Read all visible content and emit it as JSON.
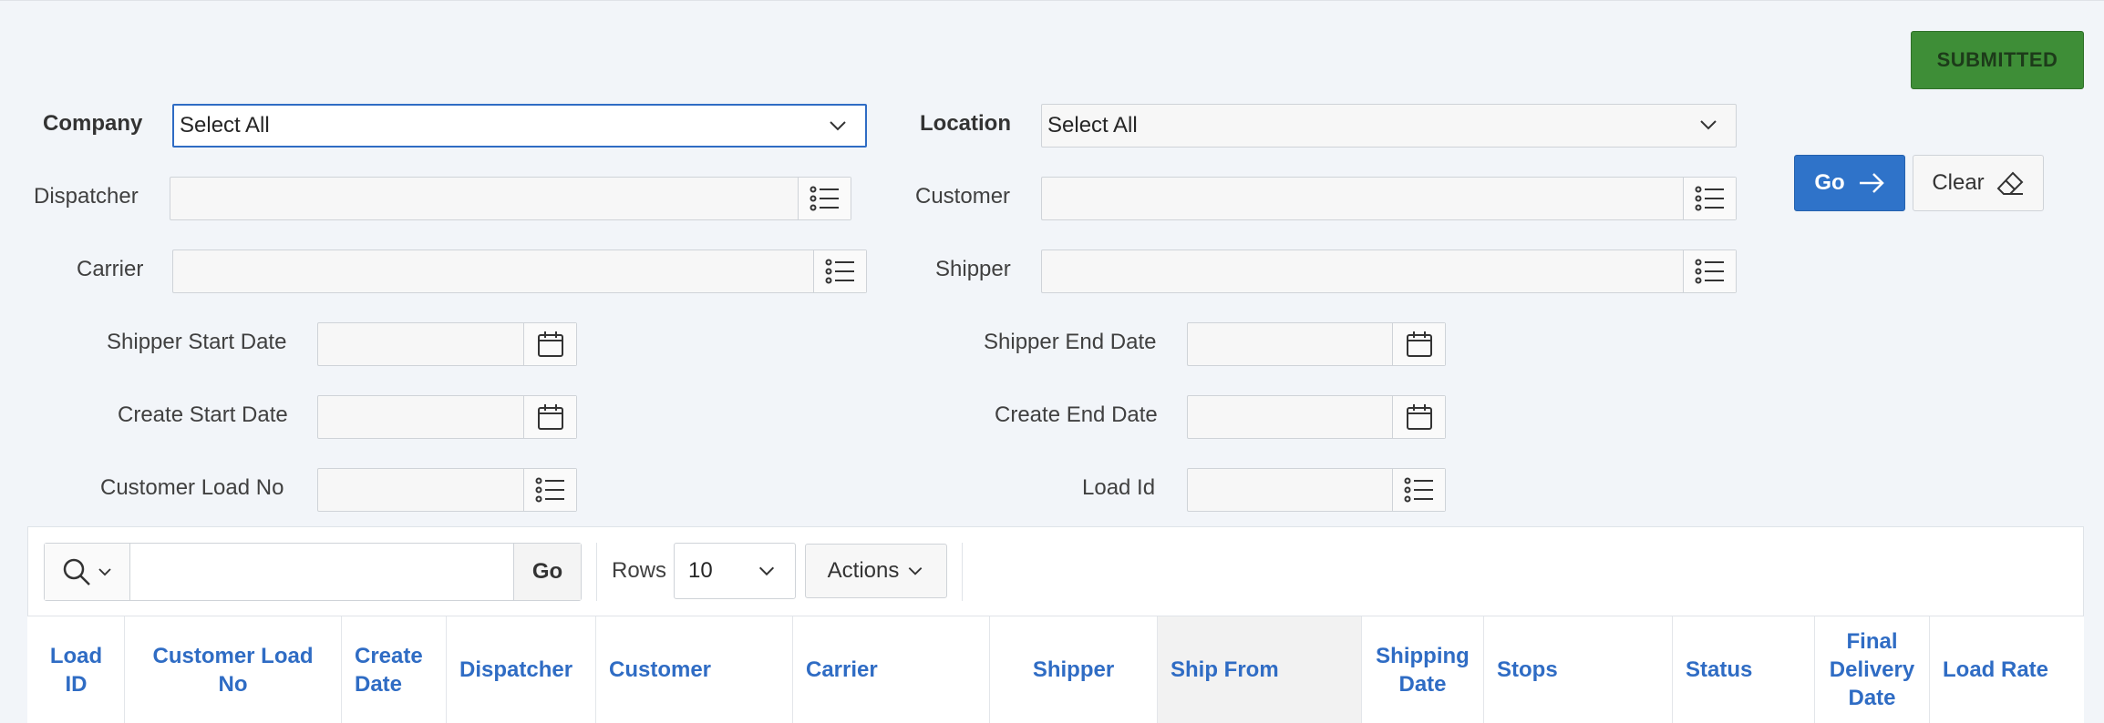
{
  "status_button": "SUBMITTED",
  "filters": {
    "company": {
      "label": "Company",
      "value": "Select All"
    },
    "location": {
      "label": "Location",
      "value": "Select All"
    },
    "dispatcher": {
      "label": "Dispatcher",
      "value": ""
    },
    "customer": {
      "label": "Customer",
      "value": ""
    },
    "carrier": {
      "label": "Carrier",
      "value": ""
    },
    "shipper": {
      "label": "Shipper",
      "value": ""
    },
    "shipper_start_date": {
      "label": "Shipper Start Date",
      "value": ""
    },
    "shipper_end_date": {
      "label": "Shipper End Date",
      "value": ""
    },
    "create_start_date": {
      "label": "Create Start Date",
      "value": ""
    },
    "create_end_date": {
      "label": "Create End Date",
      "value": ""
    },
    "customer_load_no": {
      "label": "Customer Load No",
      "value": ""
    },
    "load_id": {
      "label": "Load Id",
      "value": ""
    }
  },
  "buttons": {
    "go": "Go",
    "clear": "Clear"
  },
  "report_toolbar": {
    "search_value": "",
    "search_go": "Go",
    "rows_label": "Rows",
    "rows_value": "10",
    "actions_label": "Actions"
  },
  "table": {
    "columns": [
      "Load ID",
      "Customer Load No",
      "Create Date",
      "Dispatcher",
      "Customer",
      "Carrier",
      "Shipper",
      "Ship From",
      "Shipping Date",
      "Stops",
      "Status",
      "Final Delivery Date",
      "Load Rate"
    ]
  },
  "icons": {
    "list": "list-icon",
    "calendar": "calendar-icon",
    "chevron": "chevron-down-icon",
    "search": "search-icon",
    "arrow": "arrow-right-icon",
    "eraser": "eraser-icon"
  },
  "colors": {
    "primary": "#2f73c9",
    "success": "#3e8e37",
    "link": "#2f6cc4"
  }
}
